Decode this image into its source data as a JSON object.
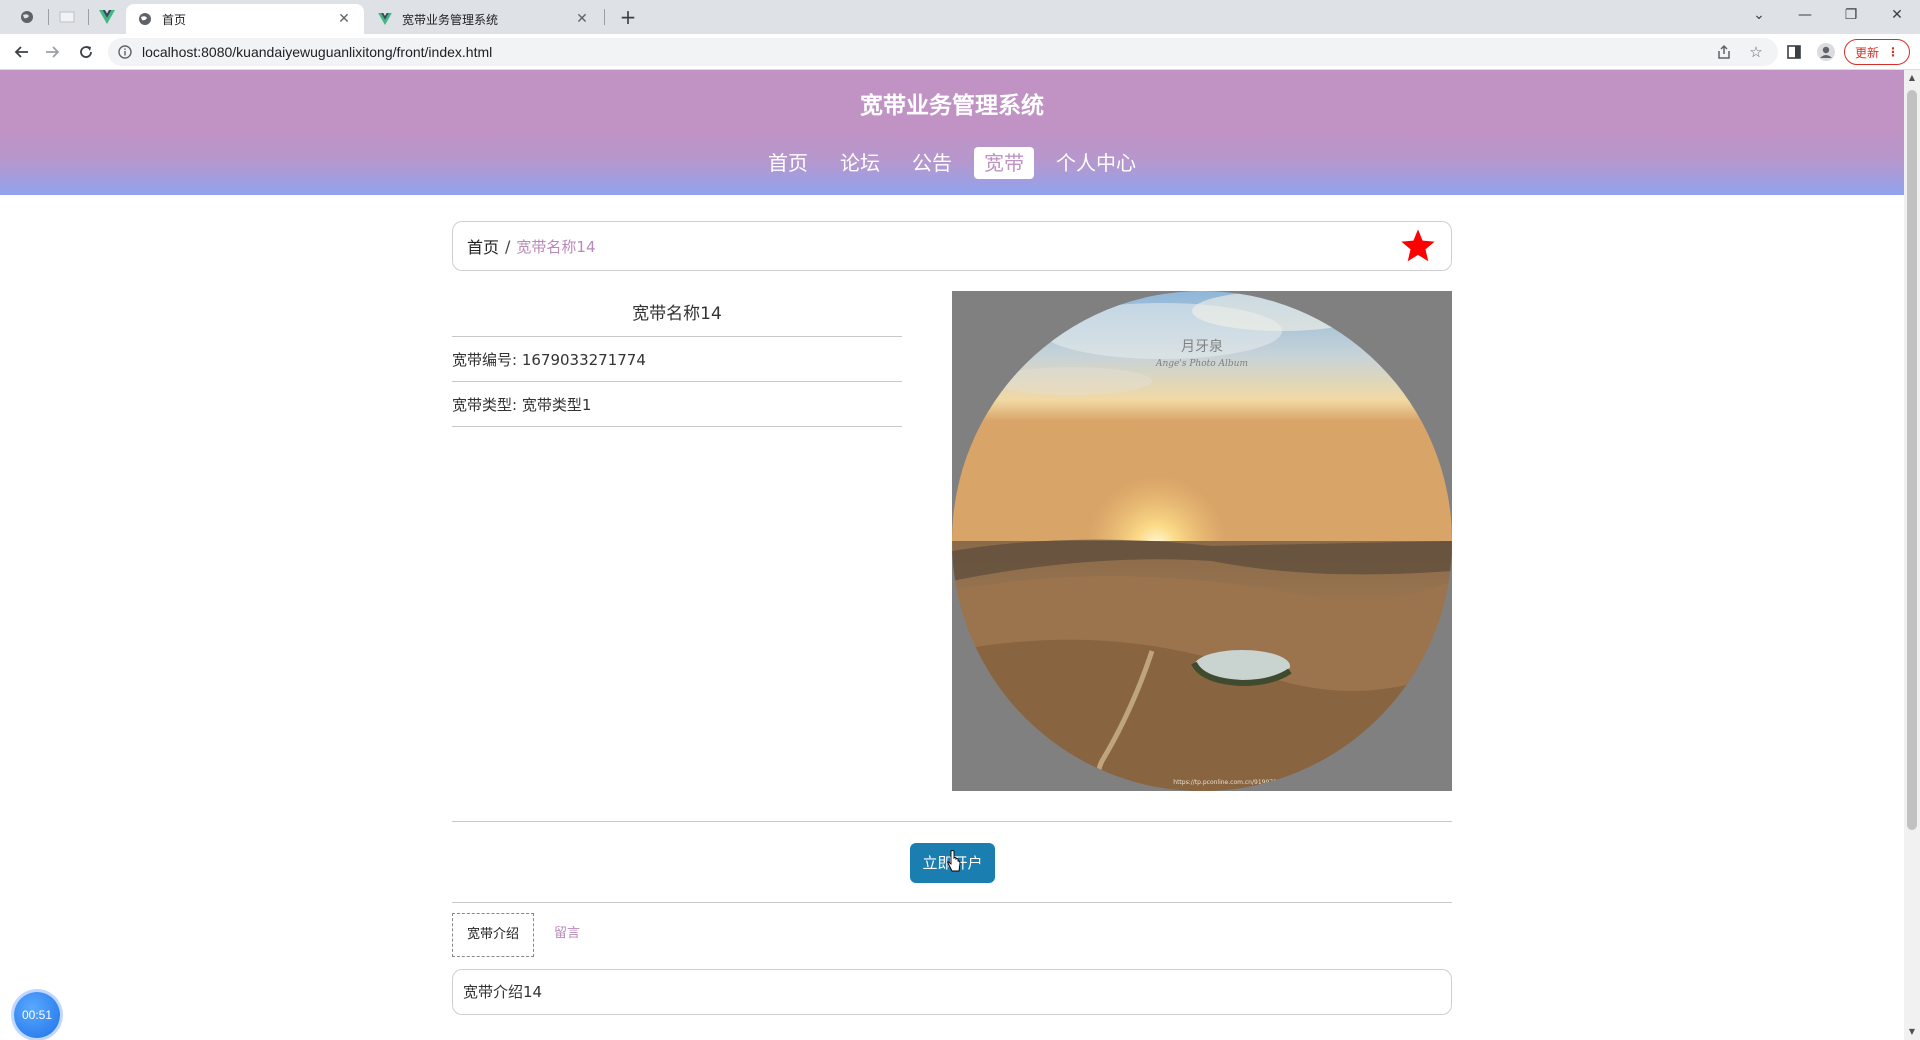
{
  "browser": {
    "tabs": [
      {
        "title": "首页",
        "icon": "globe-icon",
        "active": true
      },
      {
        "title": "宽带业务管理系统",
        "icon": "vue-icon",
        "active": false
      }
    ],
    "url": "localhost:8080/kuandaiyewuguanlixitong/front/index.html",
    "update_label": "更新"
  },
  "site": {
    "title": "宽带业务管理系统",
    "nav": [
      {
        "label": "首页",
        "active": false
      },
      {
        "label": "论坛",
        "active": false
      },
      {
        "label": "公告",
        "active": false
      },
      {
        "label": "宽带",
        "active": true
      },
      {
        "label": "个人中心",
        "active": false
      }
    ],
    "accent_color": "#c093c4"
  },
  "breadcrumb": {
    "home": "首页",
    "separator": "/",
    "current": "宽带名称14"
  },
  "detail": {
    "name": "宽带名称14",
    "rows": [
      {
        "label": "宽带编号: ",
        "value": "1679033271774"
      },
      {
        "label": "宽带类型: ",
        "value": "宽带类型1"
      }
    ],
    "photo_alt": "desert oasis sunset photo",
    "photo_watermark": "月牙泉",
    "photo_watermark_sub": "Ange's Photo Album",
    "photo_credit": "https://tp.pconline.com.cn/9199788"
  },
  "actions": {
    "open_account_label": "立即开户"
  },
  "tabs": [
    {
      "label": "宽带介绍",
      "active": true
    },
    {
      "label": "留言",
      "active": false
    }
  ],
  "intro_text": "宽带介绍14",
  "timer": "00:51"
}
